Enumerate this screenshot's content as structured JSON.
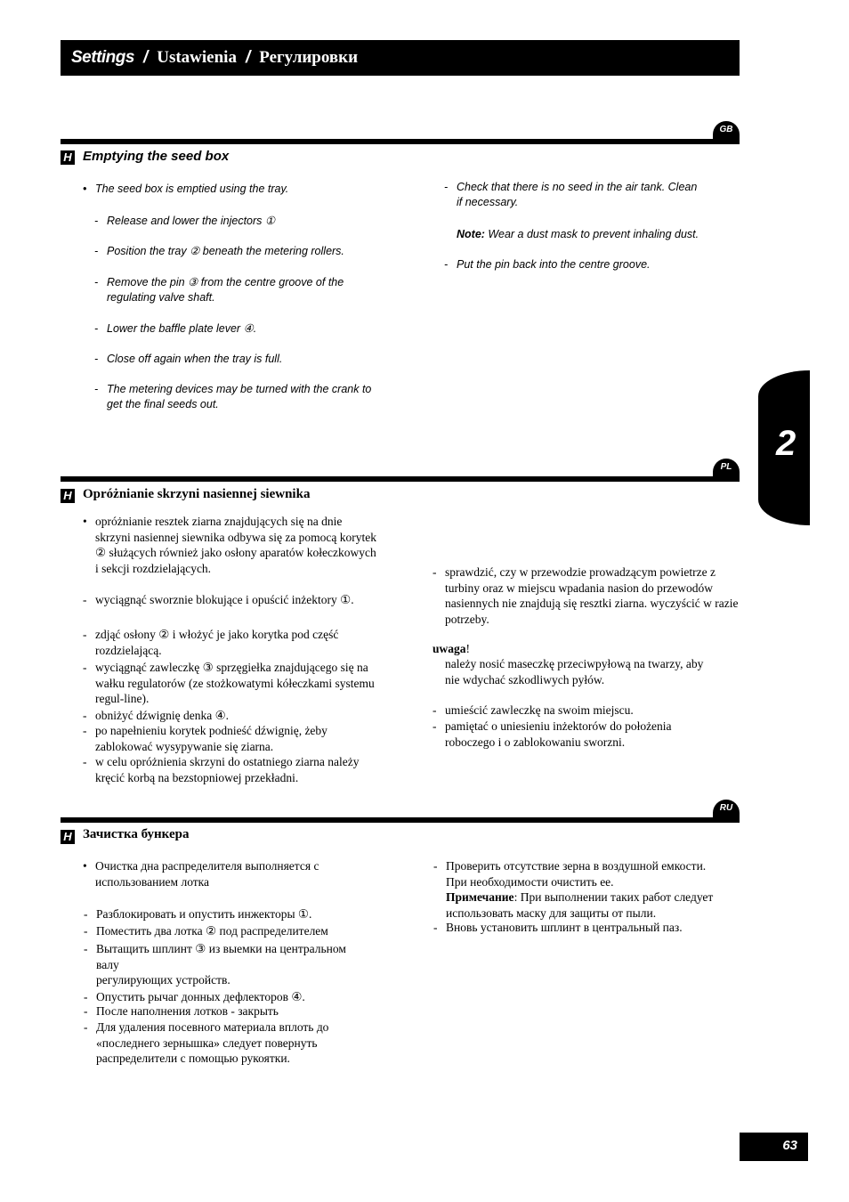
{
  "header": {
    "title_en": "Settings",
    "separator": "/",
    "title_pl": "Ustawienia",
    "title_ru": "Регулировки"
  },
  "section_marker": "H",
  "chapter": "2",
  "page_number": "63",
  "gb": {
    "lang": "GB",
    "title": "Emptying the seed box",
    "intro": "The seed box is emptied using the tray.",
    "left_items": [
      "Release and lower the injectors ①",
      "Position the tray ② beneath the metering rollers.",
      "Remove the pin ③ from the centre groove of the regulating valve shaft.",
      "Lower the baffle plate lever ④.",
      "Close off again when the tray is full.",
      "The metering devices may be turned with the crank to get the final seeds out."
    ],
    "right_item_1": "Check that there is no seed in the air tank. Clean if necessary.",
    "note_label": "Note:",
    "note_text": " Wear a dust mask to prevent inhaling dust.",
    "right_item_2": "Put the pin back into the centre groove."
  },
  "pl": {
    "lang": "PL",
    "title": "Opróżnianie skrzyni nasiennej siewnika",
    "intro": "opróżnianie resztek ziarna znajdujących się na dnie skrzyni nasiennej siewnika odbywa się za pomocą korytek ② służących również jako osłony aparatów kołeczkowych i sekcji rozdzielających.",
    "left_items": [
      "wyciągnąć sworznie blokujące i opuścić inżektory ①.",
      "zdjąć osłony ② i włożyć je jako korytka pod część rozdzielającą.",
      "wyciągnąć zawleczkę ③ sprzęgiełka znajdującego się na wałku regulatorów (ze stożkowatymi kółeczkami systemu regul-line).",
      "obniżyć dźwignię denka ④.",
      "po napełnieniu korytek podnieść dźwignię, żeby zablokować wysypywanie się ziarna.",
      "w celu opróżnienia skrzyni do ostatniego ziarna należy kręcić korbą na bezstopniowej przekładni."
    ],
    "right_item_1": "sprawdzić, czy w przewodzie prowadzącym powietrze z turbiny oraz w miejscu wpadania nasion do przewodów nasiennych nie znajdują się resztki ziarna. wyczyścić w razie potrzeby.",
    "note_label": "uwaga",
    "note_excl": "!",
    "note_text": "należy nosić maseczkę przeciwpyłową na twarzy, aby nie wdychać szkodliwych pyłów.",
    "right_items_2": [
      "umieścić zawleczkę na swoim miejscu.",
      "pamiętać o uniesieniu inżektorów do położenia roboczego i o zablokowaniu sworzni."
    ]
  },
  "ru": {
    "lang": "RU",
    "title": "Зачистка бункера",
    "intro": "Очистка дна распределителя выполняется с использованием лотка",
    "left_items": [
      "Разблокировать и опустить инжекторы ①.",
      "Поместить два лотка ② под распределителем",
      "Вытащить шплинт ③ из выемки на центральном валу",
      "Опустить рычаг донных дефлекторов ④.",
      "После наполнения лотков - закрыть",
      "Для удаления посевного материала вплоть до «последнего зернышка» следует повернуть распределители с помощью рукоятки."
    ],
    "left_item_3_cont": "регулирующих устройств.",
    "right_item_1": "Проверить отсутствие зерна в воздушной емкости. При необходимости очистить ее.",
    "note_label": "Примечание",
    "note_text": ": При выполнении таких работ следует использовать маску для защиты от пыли.",
    "right_item_2": "Вновь установить шплинт в центральный паз."
  },
  "markers": {
    "bullet": "•",
    "dash": "-"
  }
}
